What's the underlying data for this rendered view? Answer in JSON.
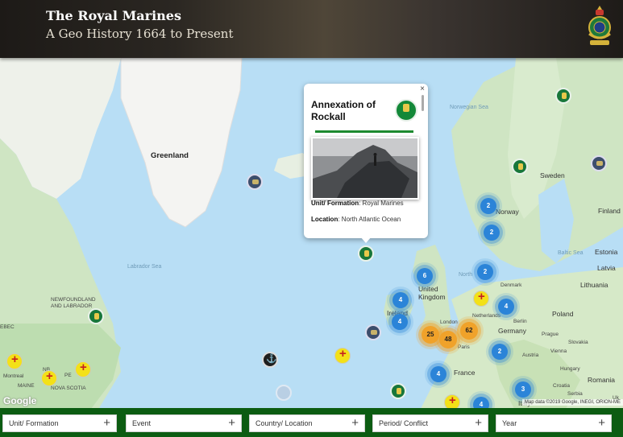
{
  "header": {
    "title": "The Royal Marines",
    "subtitle": "A Geo History 1664 to Present"
  },
  "map": {
    "labels": {
      "greenland": "Greenland",
      "norwegian_sea": "Norwegian Sea",
      "labrador_sea": "Labrador Sea",
      "newfoundland": "NEWFOUNDLAND AND LABRADOR",
      "sweden": "Sweden",
      "norway": "Norway",
      "finland": "Finland",
      "baltic_sea": "Baltic Sea",
      "estonia": "Estonia",
      "latvia": "Latvia",
      "lithuania": "Lithuania",
      "denmark": "Denmark",
      "north": "North",
      "united_kingdom": "United Kingdom",
      "ireland": "Ireland",
      "london": "London",
      "netherlands": "Netherlands",
      "berlin": "Berlin",
      "poland": "Poland",
      "germany": "Germany",
      "prague": "Prague",
      "paris": "Paris",
      "vienna": "Vienna",
      "slovakia": "Slovakia",
      "hungary": "Hungary",
      "austria": "Austria",
      "france": "France",
      "croatia": "Croatia",
      "serbia": "Serbia",
      "romania": "Romania",
      "italy": "Italy",
      "montreal": "Montreal",
      "maine": "MAINE",
      "nova_scotia": "NOVA SCOTIA",
      "nb": "NB",
      "pe": "PE",
      "quebec": "EBEC",
      "ukraine": "Uk"
    },
    "clusters": [
      {
        "label": "2",
        "color": "blue"
      },
      {
        "label": "2",
        "color": "blue"
      },
      {
        "label": "2",
        "color": "blue"
      },
      {
        "label": "6",
        "color": "blue"
      },
      {
        "label": "4",
        "color": "blue"
      },
      {
        "label": "4",
        "color": "blue"
      },
      {
        "label": "4",
        "color": "blue"
      },
      {
        "label": "2",
        "color": "blue"
      },
      {
        "label": "4",
        "color": "blue"
      },
      {
        "label": "3",
        "color": "blue"
      },
      {
        "label": "4",
        "color": "blue"
      },
      {
        "label": "25",
        "color": "orange"
      },
      {
        "label": "48",
        "color": "orange"
      },
      {
        "label": "62",
        "color": "orange"
      }
    ],
    "google_logo": "Google",
    "attribution": "Map data ©2019 Google, INEGI, ORION-ME"
  },
  "popup": {
    "title": "Annexation of Rockall",
    "close": "×",
    "unit_label": "Unit/ Formation",
    "unit_value": ": Royal Marines",
    "location_label": "Location",
    "location_value": ": North Atlantic Ocean"
  },
  "filters": [
    {
      "label": "Unit/ Formation"
    },
    {
      "label": "Event"
    },
    {
      "label": "Country/ Location"
    },
    {
      "label": "Period/ Conflict"
    },
    {
      "label": "Year"
    }
  ],
  "colors": {
    "filter_bar": "#0c5c12",
    "cluster_blue": "#2b84d8",
    "cluster_orange": "#f0a22a",
    "marker_green": "#18773a"
  }
}
